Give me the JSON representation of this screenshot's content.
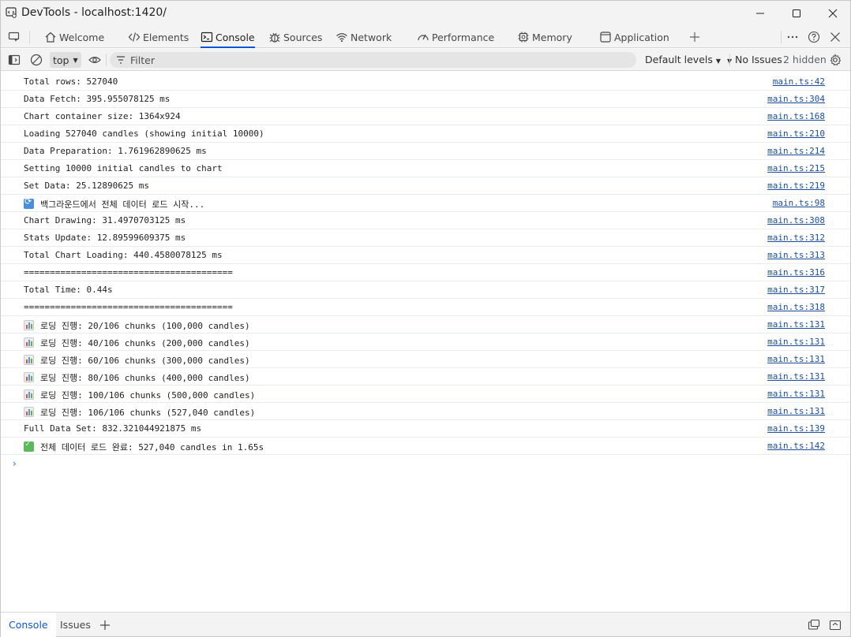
{
  "window": {
    "title": "DevTools - localhost:1420/"
  },
  "tabs": [
    {
      "label": "Welcome",
      "icon": "home-icon"
    },
    {
      "label": "Elements",
      "icon": "code-icon"
    },
    {
      "label": "Console",
      "icon": "console-icon",
      "active": true
    },
    {
      "label": "Sources",
      "icon": "bug-icon"
    },
    {
      "label": "Network",
      "icon": "wifi-icon"
    },
    {
      "label": "Performance",
      "icon": "gauge-icon"
    },
    {
      "label": "Memory",
      "icon": "chip-icon"
    },
    {
      "label": "Application",
      "icon": "app-icon"
    }
  ],
  "console_toolbar": {
    "context": "top",
    "filter_placeholder": "Filter",
    "levels": "Default levels",
    "issues": "No Issues",
    "hidden": "2 hidden"
  },
  "logs": [
    {
      "msg": "Total rows: 527040",
      "src": "main.ts:42"
    },
    {
      "msg": "Data Fetch: 395.955078125 ms",
      "src": "main.ts:304"
    },
    {
      "msg": "Chart container size: 1364x924",
      "src": "main.ts:168"
    },
    {
      "msg": "Loading 527040 candles (showing initial 10000)",
      "src": "main.ts:210"
    },
    {
      "msg": "Data Preparation: 1.761962890625 ms",
      "src": "main.ts:214"
    },
    {
      "msg": "Setting 10000 initial candles to chart",
      "src": "main.ts:215"
    },
    {
      "msg": "Set Data: 25.12890625 ms",
      "src": "main.ts:219"
    },
    {
      "msg": "백그라운드에서 전체 데이터 로드 시작...",
      "src": "main.ts:98",
      "emoji": "sync"
    },
    {
      "msg": "Chart Drawing: 31.4970703125 ms",
      "src": "main.ts:308"
    },
    {
      "msg": "Stats Update: 12.89599609375 ms",
      "src": "main.ts:312"
    },
    {
      "msg": "Total Chart Loading: 440.4580078125 ms",
      "src": "main.ts:313"
    },
    {
      "msg": "========================================",
      "src": "main.ts:316"
    },
    {
      "msg": "Total Time: 0.44s",
      "src": "main.ts:317"
    },
    {
      "msg": "========================================",
      "src": "main.ts:318"
    },
    {
      "msg": "로딩 진행: 20/106 chunks (100,000 candles)",
      "src": "main.ts:131",
      "emoji": "chart"
    },
    {
      "msg": "로딩 진행: 40/106 chunks (200,000 candles)",
      "src": "main.ts:131",
      "emoji": "chart"
    },
    {
      "msg": "로딩 진행: 60/106 chunks (300,000 candles)",
      "src": "main.ts:131",
      "emoji": "chart"
    },
    {
      "msg": "로딩 진행: 80/106 chunks (400,000 candles)",
      "src": "main.ts:131",
      "emoji": "chart"
    },
    {
      "msg": "로딩 진행: 100/106 chunks (500,000 candles)",
      "src": "main.ts:131",
      "emoji": "chart"
    },
    {
      "msg": "로딩 진행: 106/106 chunks (527,040 candles)",
      "src": "main.ts:131",
      "emoji": "chart"
    },
    {
      "msg": "Full Data Set: 832.321044921875 ms",
      "src": "main.ts:139"
    },
    {
      "msg": "전체 데이터 로드 완료: 527,040 candles in 1.65s",
      "src": "main.ts:142",
      "emoji": "check"
    }
  ],
  "drawer": {
    "tabs": [
      {
        "label": "Console",
        "active": true
      },
      {
        "label": "Issues"
      }
    ]
  },
  "colors": {
    "accent": "#0b57d0",
    "link": "#1a4fa0",
    "chrome_bg": "#f3f3f3"
  }
}
